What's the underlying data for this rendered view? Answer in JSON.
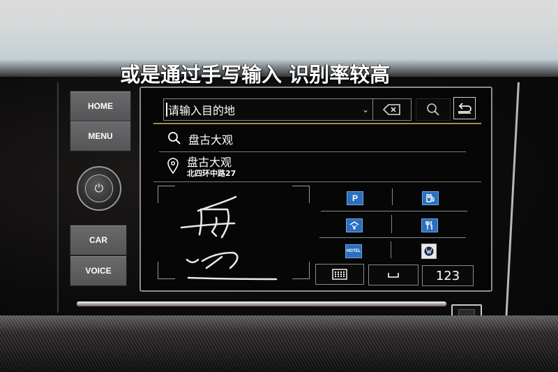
{
  "caption": "或是通过手写输入 识别率较高",
  "hardware_buttons": {
    "home": "HOME",
    "menu": "MENU",
    "car": "CAR",
    "voice": "VOICE",
    "power_icon": "⏻"
  },
  "navigation": {
    "search": {
      "placeholder": "请输入目的地",
      "value": "",
      "dropdown_icon": "⌄",
      "backspace_icon": "⌫",
      "search_icon": "⚲",
      "back_icon": "↩"
    },
    "results": [
      {
        "type": "search-suggestion",
        "icon": "search-icon",
        "title": "盘古大观"
      },
      {
        "type": "place",
        "icon": "location-pin-icon",
        "title": "盘古大观",
        "subtitle": "北四环中路27"
      }
    ],
    "handwriting": {
      "recognized_strokes": [
        "毋",
        "四"
      ]
    },
    "poi_categories": [
      {
        "name": "parking",
        "label": "P"
      },
      {
        "name": "fuel-station",
        "label": "⛽"
      },
      {
        "name": "service-area",
        "label": "Y"
      },
      {
        "name": "restaurant",
        "label": "🍴"
      },
      {
        "name": "hotel",
        "label": "HOTEL"
      },
      {
        "name": "vw-dealer",
        "label": "VW"
      }
    ],
    "keyboard_row": {
      "keyboard_icon": "⌨",
      "space_label": "␣",
      "numeric_label": "123"
    }
  },
  "colors": {
    "accent_gold": "#a88a4a",
    "poi_blue": "#2a6fc0"
  }
}
